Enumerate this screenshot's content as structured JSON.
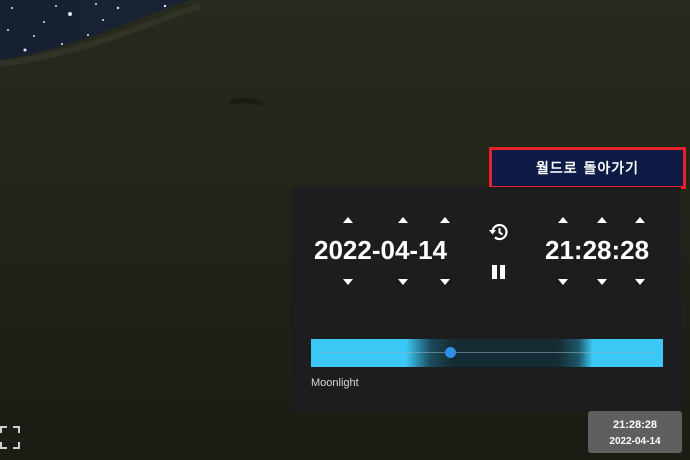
{
  "header": {
    "return_button_label": "월드로 돌아가기"
  },
  "time_panel": {
    "date_value": "2022-04-14",
    "time_value": "21:28:28",
    "slider_label": "Moonlight"
  },
  "corner_clock": {
    "time": "21:28:28",
    "date": "2022-04-14"
  },
  "icons": [
    "expand-icon",
    "reset-time-icon",
    "pause-icon",
    "arrow-up-icon",
    "arrow-down-icon"
  ],
  "colors": {
    "accent_blue": "#2d8fe6",
    "slider_bright": "#3cc8f5",
    "return_button_bg": "#0c1a45",
    "return_button_border": "#e8202a",
    "panel_bg": "#1d1d1f"
  }
}
